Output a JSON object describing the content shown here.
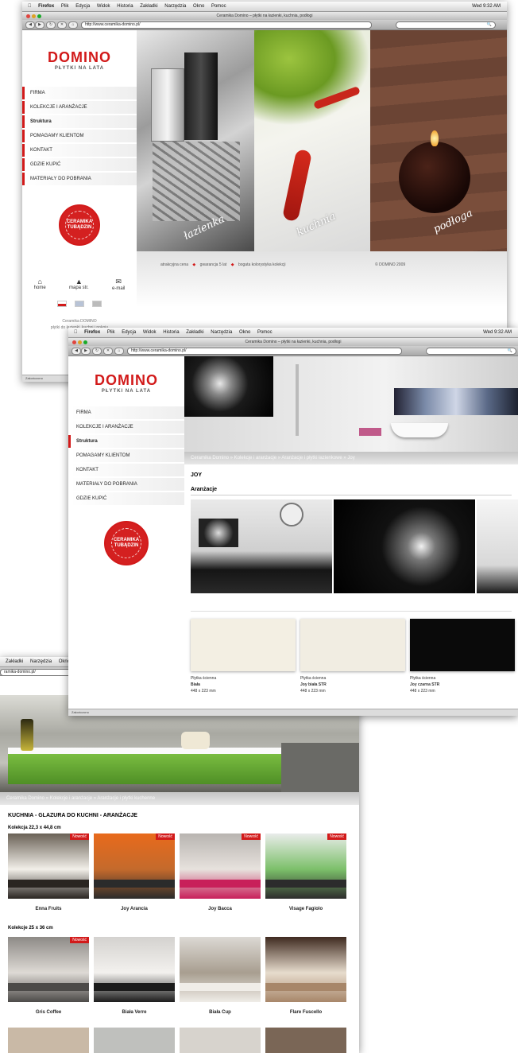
{
  "window1": {
    "menubar": [
      "Firefox",
      "Plik",
      "Edycja",
      "Widok",
      "Historia",
      "Zakładki",
      "Narzędzia",
      "Okno",
      "Pomoc"
    ],
    "clock": "Wed 9:32 AM",
    "title": "Ceramika Domino – płytki na łazienki, kuchnia, podłogi",
    "url": "http://www.ceramika-domino.pl/",
    "logo": "DOMINO",
    "tagline": "PŁYTKI NA LATA",
    "nav": [
      "FIRMA",
      "KOLEKCJE I ARANŻACJE",
      "Struktura",
      "POMAGAMY KLIENTOM",
      "KONTAKT",
      "GDZIE KUPIĆ",
      "MATERIAŁY DO POBRANIA"
    ],
    "stamp": [
      "CERAMIKA",
      "TUBĄDZIN"
    ],
    "icons": [
      "home",
      "mapa str.",
      "e-mail"
    ],
    "footer_text": [
      "Ceramika DOMINO",
      "płytki do łazienki, kuchni i pokoju"
    ],
    "panel_labels": [
      "łazienka",
      "kuchnia",
      "podłoga"
    ],
    "features": [
      "atrakcyjna cena",
      "gwarancja 5 lat",
      "bogata kolorystyka kolekcji"
    ],
    "copyright": "© DOMINO 2009",
    "status": "Zakończono"
  },
  "window2": {
    "menubar": [
      "Firefox",
      "Plik",
      "Edycja",
      "Widok",
      "Historia",
      "Zakładki",
      "Narzędzia",
      "Okno",
      "Pomoc"
    ],
    "clock": "Wed 9:32 AM",
    "title": "Ceramika Domino – płytki na łazienki, kuchnia, podłogi",
    "url": "http://www.ceramika-domino.pl/",
    "logo": "DOMINO",
    "tagline": "PŁYTKI NA LATA",
    "nav": [
      "FIRMA",
      "KOLEKCJE I ARANŻACJE",
      "Struktura",
      "POMAGAMY KLIENTOM",
      "KONTAKT",
      "MATERIAŁY DO POBRANIA",
      "GDZIE KUPIĆ"
    ],
    "stamp": [
      "CERAMIKA",
      "TUBĄDZIN"
    ],
    "breadcrumb": "Ceramika Domino  »  Kolekcje i aranżacje  »  Aranżacje i płytki łazienkowe  »  Joy",
    "heading": "JOY",
    "section": "Aranżacje",
    "tiles": [
      {
        "type": "Płytka ścienna",
        "name": "Biała",
        "size": "448 x 223 mm",
        "color": "#f3efe3"
      },
      {
        "type": "Płytka ścienna",
        "name": "Joy biała STR",
        "size": "448 x 223 mm",
        "color": "#f1ede2"
      },
      {
        "type": "Płytka ścienna",
        "name": "Joy czarna STR",
        "size": "448 x 223 mm",
        "color": "#0a0a0a"
      }
    ],
    "status": "Zakończono"
  },
  "window3": {
    "menubar": [
      "Zakładki",
      "Narzędzia",
      "Okno"
    ],
    "url": "ramika-domino.pl/",
    "breadcrumb": "Ceramika Domino  »  Kolekcje i aranżacje  »  Aranżacje i płytki kuchenne",
    "heading": "KUCHNIA - GLAZURA DO KUCHNI - ARANŻACJE",
    "group1": "Kolekcja 22,3 x 44,8 cm",
    "group2": "Kolekcje 25 x 36 cm",
    "badge": "Nowość",
    "row1": [
      {
        "name": "Enna Fruits",
        "a": "#6b6257",
        "b": "#2a2521",
        "c": "#f2efe9",
        "new": true
      },
      {
        "name": "Joy Arancia",
        "a": "#e86a1c",
        "b": "#2b2b2b",
        "c": "#c46a2c",
        "new": true
      },
      {
        "name": "Joy Bacca",
        "a": "#b8b4b0",
        "b": "#c8205a",
        "c": "#e7e2dd",
        "new": true
      },
      {
        "name": "Visage Fagiolo",
        "a": "#e9ecea",
        "b": "#2c2c2c",
        "c": "#7cc06a",
        "new": true
      }
    ],
    "row2": [
      {
        "name": "Gris Coffee",
        "a": "#8d8a86",
        "b": "#4c4a48",
        "c": "#dedad5",
        "new": true
      },
      {
        "name": "Biała Verre",
        "a": "#d4d2cf",
        "b": "#1b1b1b",
        "c": "#f3f1ee",
        "new": false
      },
      {
        "name": "Biała Cup",
        "a": "#dcd9d4",
        "b": "#f0ede8",
        "c": "#a89e90",
        "new": false
      },
      {
        "name": "Flare Fuscello",
        "a": "#3f2a20",
        "b": "#a78669",
        "c": "#e7dccd",
        "new": false
      }
    ]
  }
}
